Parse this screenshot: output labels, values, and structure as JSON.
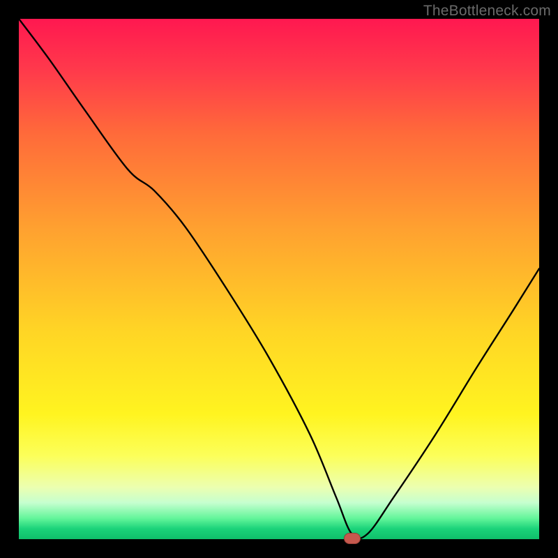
{
  "watermark": "TheBottleneck.com",
  "chart_data": {
    "type": "line",
    "title": "",
    "xlabel": "",
    "ylabel": "",
    "xlim": [
      0,
      100
    ],
    "ylim": [
      0,
      100
    ],
    "grid": false,
    "legend": false,
    "marker": {
      "x": 64,
      "y": 0
    },
    "series": [
      {
        "name": "bottleneck-curve",
        "color": "#000000",
        "x": [
          0,
          6,
          13,
          21,
          26,
          32,
          40,
          48,
          56,
          61,
          64,
          67,
          72,
          80,
          88,
          95,
          100
        ],
        "y": [
          100,
          92,
          82,
          71,
          67,
          60,
          48,
          35,
          20,
          8,
          1,
          1,
          8,
          20,
          33,
          44,
          52
        ]
      }
    ],
    "background_gradient": {
      "direction": "vertical",
      "stops": [
        {
          "pos": 0.0,
          "color": "#ff1850"
        },
        {
          "pos": 0.1,
          "color": "#ff3a4b"
        },
        {
          "pos": 0.22,
          "color": "#ff6a3a"
        },
        {
          "pos": 0.4,
          "color": "#ffa030"
        },
        {
          "pos": 0.6,
          "color": "#ffd525"
        },
        {
          "pos": 0.76,
          "color": "#fff420"
        },
        {
          "pos": 0.84,
          "color": "#fcff5a"
        },
        {
          "pos": 0.9,
          "color": "#ecffb0"
        },
        {
          "pos": 0.93,
          "color": "#c6ffcf"
        },
        {
          "pos": 0.96,
          "color": "#63f59a"
        },
        {
          "pos": 0.98,
          "color": "#1bd37a"
        },
        {
          "pos": 1.0,
          "color": "#0fbf6a"
        }
      ]
    }
  }
}
